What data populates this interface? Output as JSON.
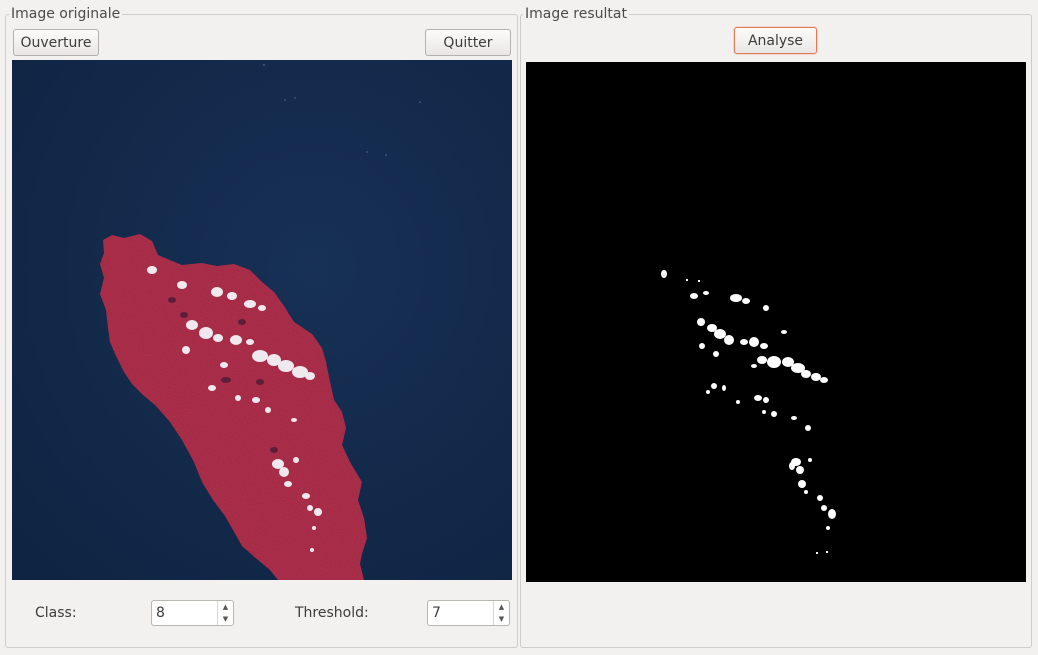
{
  "left_panel": {
    "title": "Image originale",
    "open_button": "Ouverture",
    "quit_button": "Quitter",
    "image_alt": "original satellite image"
  },
  "right_panel": {
    "title": "Image resultat",
    "analyse_button": "Analyse",
    "image_alt": "result image"
  },
  "controls": {
    "class_label": "Class:",
    "class_value": "8",
    "threshold_label": "Threshold:",
    "threshold_value": "7",
    "up_arrow": "▲",
    "down_arrow": "▼"
  },
  "colors": {
    "window_bg": "#f2f1f0",
    "ocean": "#12294a",
    "land": "#a3263e",
    "cloud": "#f4f5f8",
    "result_bg": "#000000",
    "result_fg": "#ffffff",
    "focus_border": "#e07a5a"
  }
}
